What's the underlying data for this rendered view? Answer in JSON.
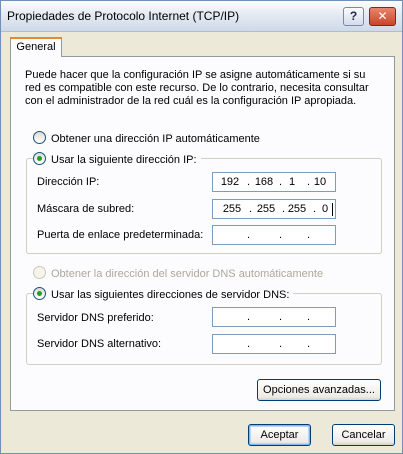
{
  "window": {
    "title": "Propiedades de Protocolo Internet (TCP/IP)",
    "help_label": "?",
    "close_label": "✕"
  },
  "tabs": [
    {
      "label": "General",
      "selected": true
    }
  ],
  "description": "Puede hacer que la configuración IP se asigne automáticamente si su red es compatible con este recurso. De lo contrario, necesita consultar con el administrador de la red cuál es la configuración IP apropiada.",
  "ip_mode": {
    "auto_label": "Obtener una dirección IP automáticamente",
    "manual_label": "Usar la siguiente dirección IP:",
    "selected": "manual"
  },
  "ip_fields": {
    "ip_label": "Dirección IP:",
    "ip_value": [
      "192",
      "168",
      "1",
      "10"
    ],
    "mask_label": "Máscara de subred:",
    "mask_value": [
      "255",
      "255",
      "255",
      "0"
    ],
    "gateway_label": "Puerta de enlace predeterminada:",
    "gateway_value": [
      "",
      "",
      "",
      ""
    ]
  },
  "dns_mode": {
    "auto_label": "Obtener la dirección del servidor DNS automáticamente",
    "auto_enabled": false,
    "manual_label": "Usar las siguientes direcciones de servidor DNS:",
    "selected": "manual"
  },
  "dns_fields": {
    "preferred_label": "Servidor DNS preferido:",
    "preferred_value": [
      "",
      "",
      "",
      ""
    ],
    "alternate_label": "Servidor DNS alternativo:",
    "alternate_value": [
      "",
      "",
      "",
      ""
    ]
  },
  "buttons": {
    "advanced_label": "Opciones avanzadas...",
    "ok_label": "Aceptar",
    "cancel_label": "Cancelar"
  },
  "ip_dot": "."
}
